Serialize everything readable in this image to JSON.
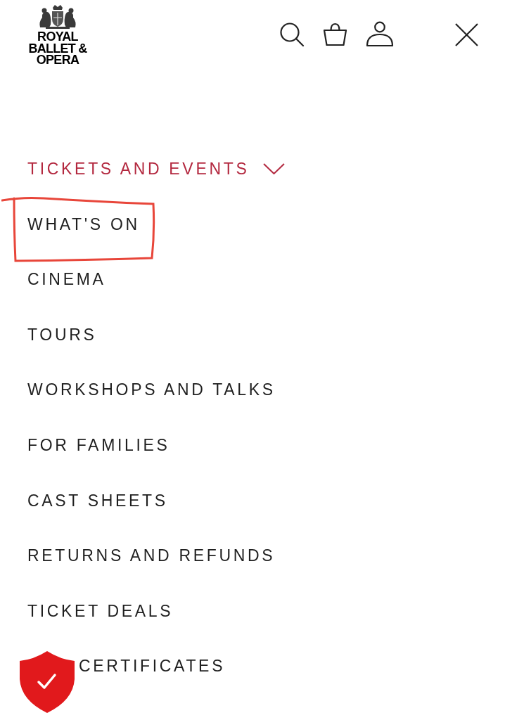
{
  "logo": {
    "lines": [
      "ROYAL",
      "BALLET &",
      "OPERA"
    ]
  },
  "menu": {
    "section": {
      "label": "TICKETS AND EVENTS",
      "expanded": true
    },
    "items": [
      {
        "label": "WHAT'S ON",
        "highlighted": true,
        "covered": false
      },
      {
        "label": "CINEMA",
        "highlighted": false,
        "covered": false
      },
      {
        "label": "TOURS",
        "highlighted": false,
        "covered": false
      },
      {
        "label": "WORKSHOPS AND TALKS",
        "highlighted": false,
        "covered": false
      },
      {
        "label": "FOR FAMILIES",
        "highlighted": false,
        "covered": false
      },
      {
        "label": "CAST SHEETS",
        "highlighted": false,
        "covered": false
      },
      {
        "label": "RETURNS AND REFUNDS",
        "highlighted": false,
        "covered": false
      },
      {
        "label": "TICKET DEALS",
        "highlighted": false,
        "covered": false
      },
      {
        "label": "CERTIFICATES",
        "highlighted": false,
        "covered": true
      }
    ]
  }
}
